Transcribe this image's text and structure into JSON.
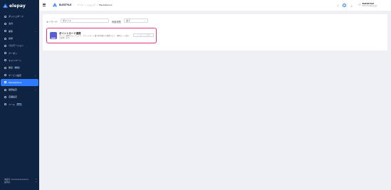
{
  "sidebar": {
    "logo_text": "elepay",
    "items": [
      {
        "label": "ダッシュボード",
        "icon": "dashboard-icon",
        "chevron": false,
        "badge": ""
      },
      {
        "label": "決済",
        "icon": "payment-icon",
        "chevron": false,
        "badge": ""
      },
      {
        "label": "顧客",
        "icon": "customer-icon",
        "chevron": true,
        "badge": ""
      },
      {
        "label": "請求",
        "icon": "invoice-icon",
        "chevron": false,
        "badge": ""
      },
      {
        "label": "プロモーション",
        "icon": "promotion-icon",
        "chevron": false,
        "badge": ""
      },
      {
        "label": "クーポン",
        "icon": "coupon-icon",
        "chevron": false,
        "badge": ""
      },
      {
        "label": "キャンペーン",
        "icon": "campaign-icon",
        "chevron": false,
        "badge": ""
      },
      {
        "label": "購買",
        "icon": "purchase-icon",
        "chevron": false,
        "badge": "BETA"
      },
      {
        "label": "サービス設定",
        "icon": "service-settings-icon",
        "chevron": true,
        "badge": ""
      },
      {
        "label": "Marketplace",
        "icon": "marketplace-icon",
        "chevron": false,
        "badge": "",
        "active": true
      },
      {
        "label": "開発設定",
        "icon": "developer-settings-icon",
        "chevron": true,
        "badge": ""
      },
      {
        "label": "店舗設定",
        "icon": "store-settings-icon",
        "chevron": false,
        "badge": ""
      },
      {
        "label": "ツール",
        "icon": "tool-icon",
        "chevron": false,
        "badge": "BETA"
      }
    ],
    "footer_line1": "事業者: xxxxxxxxxxxxxxxx",
    "footer_line2": "操作者:"
  },
  "header": {
    "account_name": "ELESTYLE",
    "breadcrumb": [
      "ツール",
      "ショップ",
      "Marketplace"
    ],
    "user_name": "ELESTYLE",
    "user_sub": "ELESTYLE株式会社"
  },
  "filters": {
    "keyword_label": "キーワード",
    "keyword_value": "ポイント",
    "status_label": "利用状態",
    "status_value": "全て"
  },
  "card": {
    "title": "ポイントカード連携",
    "description": "ポイント連携することにより、ポイントカード番号を登録する連携すると、連携カード決済で使用します。",
    "button_label": "インストール済み"
  },
  "colors": {
    "sidebar_bg": "#0f2443",
    "accent": "#2f7bff",
    "card_highlight": "#e0367e",
    "card_icon_bg": "#5b5fd0"
  }
}
